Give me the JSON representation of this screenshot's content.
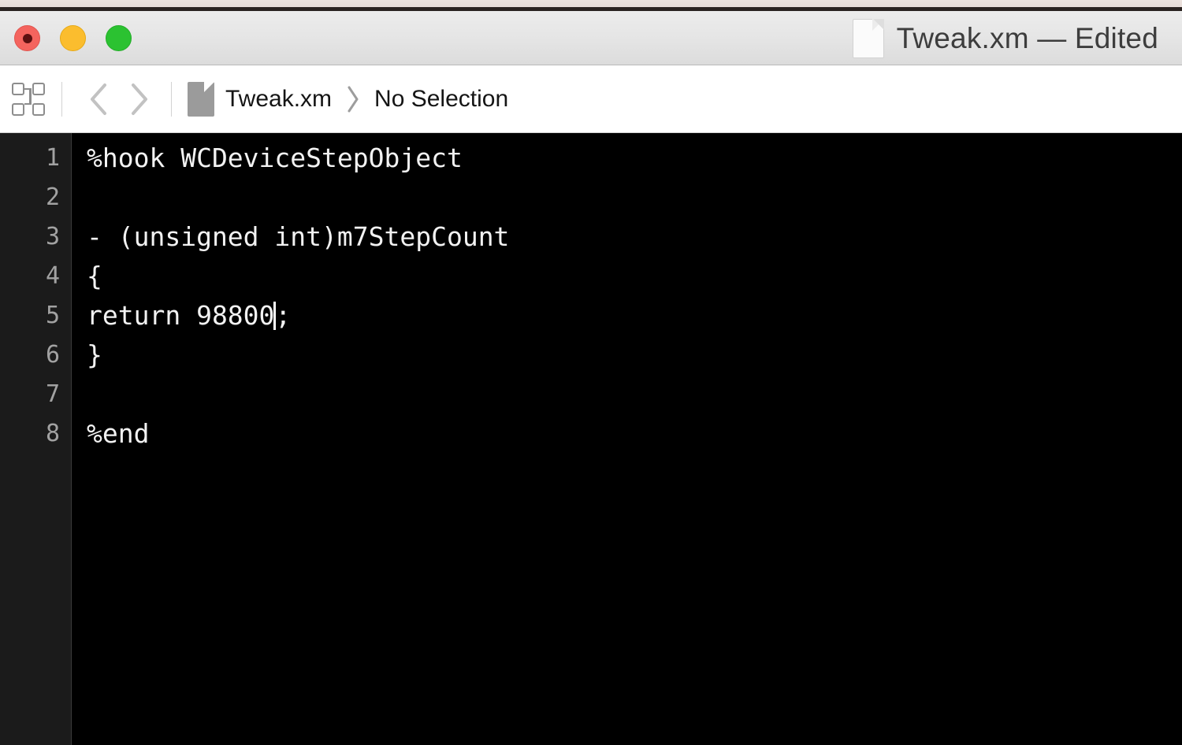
{
  "window": {
    "title": "Tweak.xm — Edited",
    "document_name": "Tweak.xm",
    "edited_suffix": "Edited",
    "icons": {
      "document": "document-icon",
      "close": "close-traffic-light",
      "minimize": "minimize-traffic-light",
      "zoom": "zoom-traffic-light"
    },
    "colors": {
      "close": "#f4645e",
      "minimize": "#fbbd2e",
      "zoom": "#2bc231",
      "titlebar_top": "#ececec",
      "titlebar_bottom": "#dcdcdc",
      "title_text": "#3d3d3d"
    }
  },
  "jumpbar": {
    "related_items_icon": "related-items-grid-icon",
    "back_icon": "chevron-left-icon",
    "forward_icon": "chevron-right-icon",
    "breadcrumb": {
      "file_icon": "file-icon",
      "items": [
        "Tweak.xm",
        "No Selection"
      ],
      "separator": "›"
    }
  },
  "editor": {
    "language": "logos-objective-c",
    "colors": {
      "background": "#000000",
      "gutter_background": "#1b1b1b",
      "gutter_text": "#a2a2a2",
      "code_text": "#f2f2f2",
      "caret": "#ffffff"
    },
    "cursor": {
      "line": 5,
      "column": 13
    },
    "lines": [
      {
        "number": "1",
        "text": "%hook WCDeviceStepObject"
      },
      {
        "number": "2",
        "text": ""
      },
      {
        "number": "3",
        "text": "- (unsigned int)m7StepCount"
      },
      {
        "number": "4",
        "text": "{"
      },
      {
        "number": "5",
        "text": "return 98800;",
        "caret_after": "return 98800"
      },
      {
        "number": "6",
        "text": "}"
      },
      {
        "number": "7",
        "text": ""
      },
      {
        "number": "8",
        "text": "%end"
      }
    ]
  }
}
